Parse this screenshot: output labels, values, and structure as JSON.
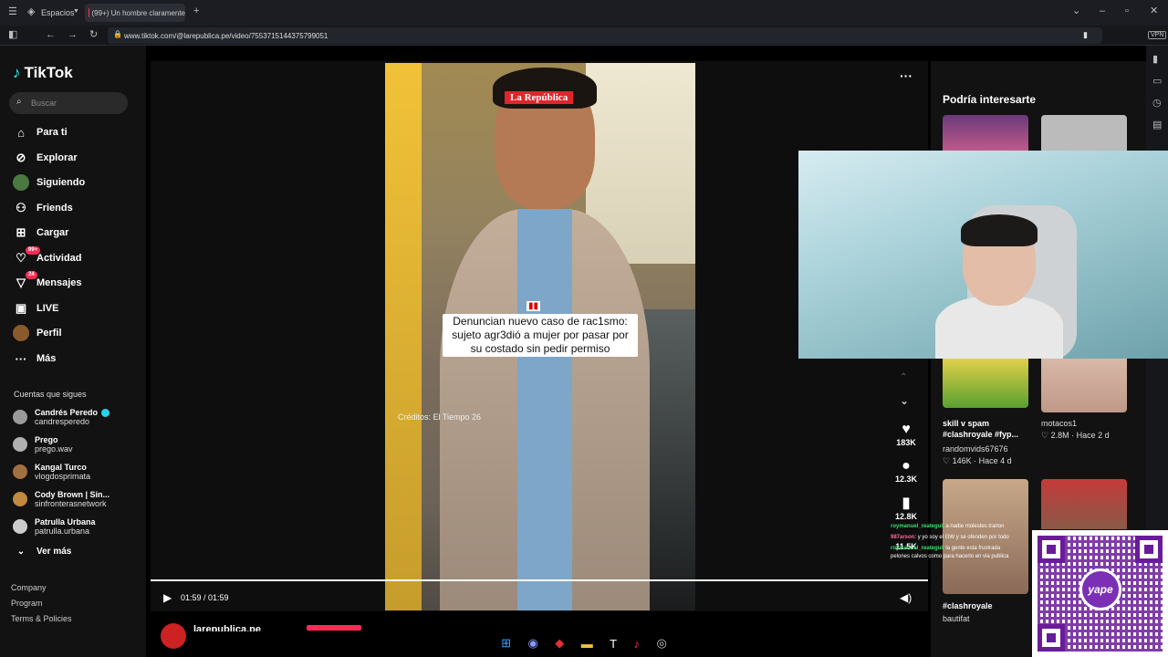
{
  "browser": {
    "workspaces_label": "Espacios",
    "tab_title": "(99+) Un hombre claramente",
    "url": "www.tiktok.com/@larepublica.pe/video/7553715144375799051",
    "vpn_label": "VPN"
  },
  "tiktok": {
    "logo": "TikTok",
    "search_placeholder": "Buscar",
    "nav": [
      {
        "label": "Para ti"
      },
      {
        "label": "Explorar"
      },
      {
        "label": "Siguiendo"
      },
      {
        "label": "Friends"
      },
      {
        "label": "Cargar"
      },
      {
        "label": "Actividad",
        "badge": "99+"
      },
      {
        "label": "Mensajes",
        "badge": "24"
      },
      {
        "label": "LIVE"
      },
      {
        "label": "Perfil"
      },
      {
        "label": "Más"
      }
    ],
    "following_title": "Cuentas que sigues",
    "following": [
      {
        "name": "Candrés Peredo",
        "handle": "candresperedo"
      },
      {
        "name": "Prego",
        "handle": "prego.wav"
      },
      {
        "name": "Kangal Turco",
        "handle": "vlogdosprimata"
      },
      {
        "name": "Cody Brown | Sin...",
        "handle": "sinfronterasnetwork"
      },
      {
        "name": "Patrulla Urbana",
        "handle": "patrulla.urbana"
      }
    ],
    "see_more": "Ver más",
    "footer": [
      "Company",
      "Program",
      "Terms & Policies"
    ]
  },
  "video": {
    "brand_tag": "La República",
    "caption": "Denuncian nuevo caso de rac1smo: sujeto agr3dió a mujer por pasar por su costado sin pedir permiso",
    "credits": "Créditos: El Tiempo 26",
    "time": "01:59 / 01:59",
    "likes": "183K",
    "comments": "12.3K",
    "saves": "12.8K",
    "shares": "11.5K",
    "author": "larepublica.pe"
  },
  "recommended": {
    "title": "Podría interesarte",
    "cards": [
      {
        "title": "skill v spam #clashroyale #fyp...",
        "author": "randomvids67676",
        "likes": "146K",
        "age": "Hace 4 d"
      },
      {
        "title": "",
        "author": "motacos1",
        "likes": "2.8M",
        "age": "Hace 2 d"
      },
      {
        "title": "#clashroyale",
        "author": "bautifat",
        "likes": "",
        "age": ""
      }
    ]
  },
  "chat": [
    {
      "user": "roymanuel_reategui",
      "text": "a nadie molestes trarlon"
    },
    {
      "user": "987arson",
      "text": "y yo soy el GW y se ofenden por todo"
    },
    {
      "user": "roymanuel_reategui",
      "text": "la gente esta frustrada"
    },
    {
      "user": "",
      "text": "pelones calvos como para hacerlo en via publica"
    }
  ],
  "qr": {
    "brand": "yape"
  },
  "colors": {
    "accent": "#fe2c55",
    "yape": "#7b2fb5"
  }
}
